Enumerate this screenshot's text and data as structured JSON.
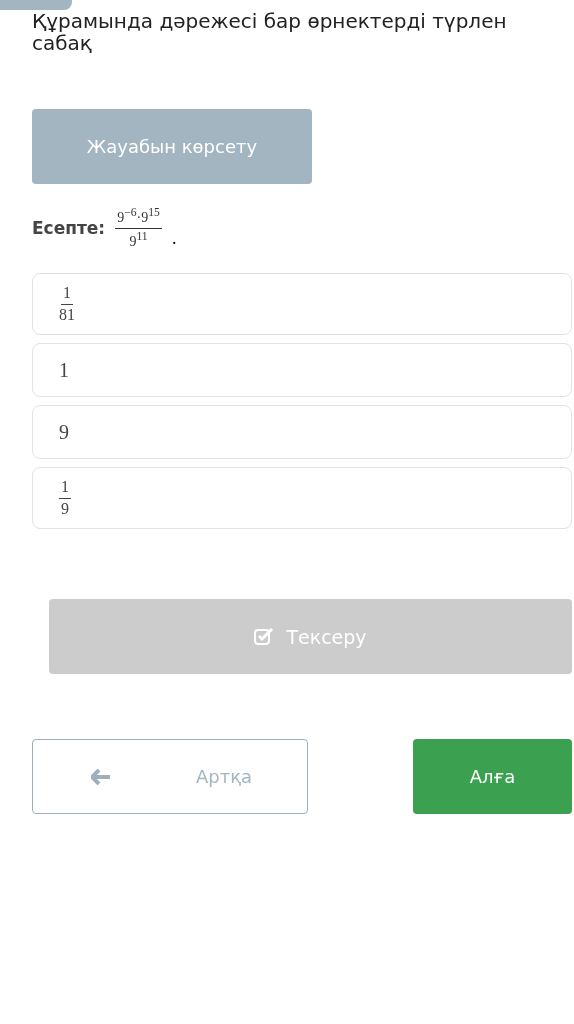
{
  "title_lines": [
    "Құрамында дәрежесі бар өрнектерді түрлен",
    "сабақ"
  ],
  "show_answer_button": "Жауабын көрсету",
  "task": {
    "label": "Есепте:",
    "numerator": "9$^{−6}$·9$^{15}$",
    "denominator": "9$^{11}$",
    "end": "."
  },
  "options": [
    {
      "kind": "fraction",
      "numerator": "1",
      "denominator": "81"
    },
    {
      "kind": "number",
      "text": "1"
    },
    {
      "kind": "number",
      "text": "9"
    },
    {
      "kind": "fraction",
      "numerator": "1",
      "denominator": "9"
    }
  ],
  "check_button": {
    "label": "Тексеру",
    "disabled": true
  },
  "back_button": "Артқа",
  "next_button": "Алға"
}
